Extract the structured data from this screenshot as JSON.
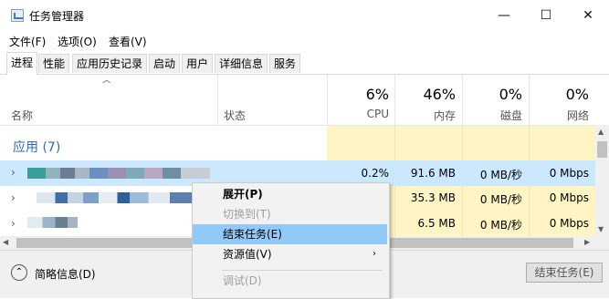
{
  "window": {
    "title": "任务管理器",
    "min": "—",
    "max": "☐",
    "close": "✕"
  },
  "menubar": {
    "file": "文件(F)",
    "options": "选项(O)",
    "view": "查看(V)"
  },
  "tabs": [
    {
      "label": "进程",
      "active": true
    },
    {
      "label": "性能"
    },
    {
      "label": "应用历史记录"
    },
    {
      "label": "启动"
    },
    {
      "label": "用户"
    },
    {
      "label": "详细信息"
    },
    {
      "label": "服务"
    }
  ],
  "header": {
    "name": "名称",
    "status": "状态",
    "cpu_pct": "6%",
    "cpu": "CPU",
    "mem_pct": "46%",
    "mem": "内存",
    "disk_pct": "0%",
    "disk": "磁盘",
    "net_pct": "0%",
    "net": "网络",
    "sort_arrow": "^"
  },
  "group": {
    "label": "应用 (7)"
  },
  "rows": [
    {
      "cpu": "0.2%",
      "mem": "91.6 MB",
      "disk": "0 MB/秒",
      "net": "0 Mbps",
      "selected": true
    },
    {
      "cpu": "",
      "mem": "35.3 MB",
      "disk": "0 MB/秒",
      "net": "0 Mbps"
    },
    {
      "cpu": "",
      "mem": "6.5 MB",
      "disk": "0 MB/秒",
      "net": "0 Mbps"
    }
  ],
  "context_menu": {
    "expand": "展开(P)",
    "switch_to": "切换到(T)",
    "end_task": "结束任务(E)",
    "resource_values": "资源值(V)",
    "debug": "调试(D)"
  },
  "footer": {
    "fewer_details": "简略信息(D)",
    "end_task_button": "结束任务(E)"
  },
  "colors": {
    "accent_blue": "#2a6ebb",
    "selected_row": "#cce8ff",
    "heat_yellow": "#fff4c4",
    "menu_highlight": "#91c9f7"
  }
}
